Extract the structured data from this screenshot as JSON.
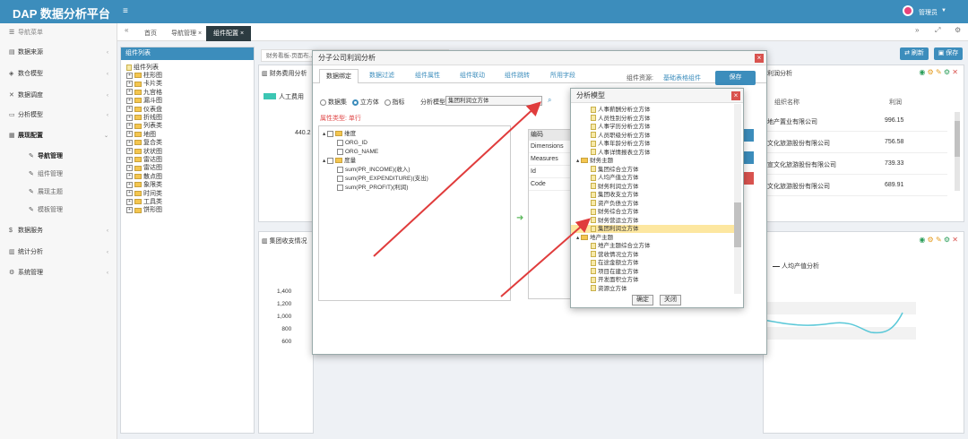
{
  "app": {
    "brand": "DAP  数据分析平台",
    "user": "管理员",
    "menu_toggle": "≡"
  },
  "sidebar": {
    "nav_label": "导航菜单",
    "items": [
      {
        "label": "数据来源",
        "icon": "db-icon"
      },
      {
        "label": "数仓模型",
        "icon": "cube-icon"
      },
      {
        "label": "数据调度",
        "icon": "tasks-icon"
      },
      {
        "label": "分析模型",
        "icon": "model-icon"
      },
      {
        "label": "展现配置",
        "icon": "display-icon"
      },
      {
        "label": "导航管理",
        "icon": "nav-icon"
      },
      {
        "label": "组件管理",
        "icon": "component-icon"
      },
      {
        "label": "展现主题",
        "icon": "theme-icon"
      },
      {
        "label": "模板管理",
        "icon": "template-icon"
      },
      {
        "label": "数据服务",
        "icon": "service-icon"
      },
      {
        "label": "统计分析",
        "icon": "chart-icon"
      },
      {
        "label": "系统管理",
        "icon": "gear-icon"
      }
    ]
  },
  "tabs": [
    {
      "label": "首页"
    },
    {
      "label": "导航管理 ×"
    },
    {
      "label": "组件配置 ×"
    }
  ],
  "tree_panel": {
    "title": "组件列表",
    "root": "组件列表",
    "items": [
      "柱形图",
      "卡片类",
      "九宫格",
      "漏斗图",
      "仪表盘",
      "折线图",
      "列表类",
      "地图",
      "复合类",
      "状状图",
      "雷达图",
      "雷达图",
      "散点图",
      "象限类",
      "时间类",
      "工具类",
      "饼形图"
    ]
  },
  "toolbar": {
    "refresh": "刷新",
    "save": "保存"
  },
  "background": {
    "breadcrumb": "财务看板-页面布...",
    "panel1_title": "财务费用分析",
    "legend1": "人工费用",
    "val1": "440.2",
    "panel2_title": "集团收支情况",
    "yticks": [
      "1,400",
      "1,200",
      "1,000",
      "800",
      "600"
    ],
    "right_legend": "人均产值分析",
    "right_cols": [
      "组织名称",
      "利润"
    ],
    "right_rows": [
      {
        "name": "地产置业有限公司",
        "value": "996.15"
      },
      {
        "name": "文化旅游股份有限公司",
        "value": "756.58"
      },
      {
        "name": "宣文化旅游股份有限公司",
        "value": "739.33"
      },
      {
        "name": "文化旅游股份有限公司",
        "value": "689.91"
      }
    ],
    "right_title": "利润分析"
  },
  "dialog": {
    "title": "分子公司利润分析",
    "tabs": [
      "数据绑定",
      "数据过滤",
      "组件属性",
      "组件联动",
      "组件跳转",
      "所用字段"
    ],
    "resource_label": "组件资源:",
    "resource_link": "基础表格组件",
    "save": "保存",
    "radios": [
      "数据集",
      "立方体",
      "指标"
    ],
    "model_label": "分析模型",
    "model_value": "集团利润立方体",
    "attr_type_label": "属性类型:",
    "attr_type_value": "单行",
    "tree": {
      "dim": "维度",
      "dim_items": [
        "ORG_ID",
        "ORG_NAME"
      ],
      "measure": "度量",
      "measure_items": [
        "sum(PR_INCOME)(收入)",
        "sum(PR_EXPENDITURE)(支出)",
        "sum(PR_PROFIT)(利润)"
      ]
    },
    "right_header": "编码",
    "right_items": [
      "Dimensions",
      "Measures",
      "Id",
      "Code"
    ]
  },
  "model_dialog": {
    "title": "分析模型",
    "items": [
      {
        "label": "人事薪酬分析立方体",
        "level": 2,
        "type": "doc"
      },
      {
        "label": "人员性别分析立方体",
        "level": 2,
        "type": "doc"
      },
      {
        "label": "人事学历分析立方体",
        "level": 2,
        "type": "doc"
      },
      {
        "label": "人员职级分析立方体",
        "level": 2,
        "type": "doc"
      },
      {
        "label": "人事年龄分析立方体",
        "level": 2,
        "type": "doc"
      },
      {
        "label": "人事详情报表立方体",
        "level": 2,
        "type": "doc"
      },
      {
        "label": "财务主题",
        "level": 1,
        "type": "folder"
      },
      {
        "label": "集团综合立方体",
        "level": 2,
        "type": "doc"
      },
      {
        "label": "人均产值立方体",
        "level": 2,
        "type": "doc"
      },
      {
        "label": "财务利润立方体",
        "level": 2,
        "type": "doc"
      },
      {
        "label": "集团收支立方体",
        "level": 2,
        "type": "doc"
      },
      {
        "label": "资产负债立方体",
        "level": 2,
        "type": "doc"
      },
      {
        "label": "财务综合立方体",
        "level": 2,
        "type": "doc"
      },
      {
        "label": "财务营运立方体",
        "level": 2,
        "type": "doc"
      },
      {
        "label": "集团利润立方体",
        "level": 2,
        "type": "doc",
        "selected": true
      },
      {
        "label": "地产主题",
        "level": 1,
        "type": "folder"
      },
      {
        "label": "地产主题综合立方体",
        "level": 2,
        "type": "doc"
      },
      {
        "label": "营收情况立方体",
        "level": 2,
        "type": "doc"
      },
      {
        "label": "在途金额立方体",
        "level": 2,
        "type": "doc"
      },
      {
        "label": "项目在建立方体",
        "level": 2,
        "type": "doc"
      },
      {
        "label": "开发面积立方体",
        "level": 2,
        "type": "doc"
      },
      {
        "label": "资源立方体",
        "level": 2,
        "type": "doc"
      }
    ],
    "ok": "确定",
    "close": "关闭"
  }
}
